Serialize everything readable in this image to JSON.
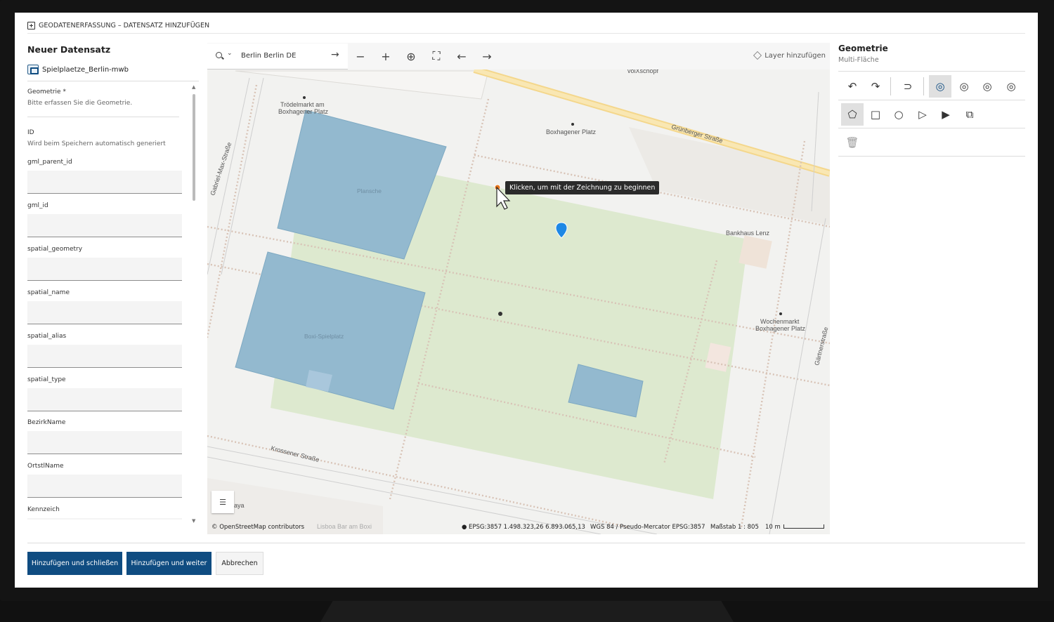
{
  "title": "GEODATENERFASSUNG – DATENSATZ HINZUFÜGEN",
  "left_panel": {
    "heading": "Neuer Datensatz",
    "dataset": "Spielplaetze_Berlin-mwb",
    "fields": [
      {
        "label": "Geometrie *",
        "hint": "Bitte erfassen Sie die Geometrie."
      },
      {
        "label": "ID",
        "hint": "Wird beim Speichern automatisch generiert"
      },
      {
        "label": "gml_parent_id",
        "value": ""
      },
      {
        "label": "gml_id",
        "value": ""
      },
      {
        "label": "spatial_geometry",
        "value": ""
      },
      {
        "label": "spatial_name",
        "value": ""
      },
      {
        "label": "spatial_alias",
        "value": ""
      },
      {
        "label": "spatial_type",
        "value": ""
      },
      {
        "label": "BezirkName",
        "value": ""
      },
      {
        "label": "OrtstlName",
        "value": ""
      },
      {
        "label": "Kennzeich",
        "value": ""
      }
    ]
  },
  "map": {
    "search": {
      "value": "Berlin  Berlin  DE"
    },
    "layer_button": "Layer hinzufügen",
    "tooltip": "Klicken, um mit der Zeichnung zu beginnen",
    "labels": {
      "troedelmarkt": "Trödelmarkt am",
      "troedelmarkt2": "Boxhagener Platz",
      "boxhagener": "Boxhagener Platz",
      "gruenberger": "Grünberger Straße",
      "gabriel": "Gabriel-Max-Straße",
      "bankhaus": "Bankhaus Lenz",
      "wochenmarkt": "Wochenmarkt",
      "wochenmarkt2": "Boxhagener Platz",
      "krossener": "Krossener Straße",
      "gaertner": "Gärtnerstraße",
      "plansche": "Plansche",
      "boxi": "Boxi-Spielplatz",
      "volxschopf": "volXschopf",
      "lisboa": "Lisboa Bar am Boxi",
      "aya": "aya"
    },
    "footer": {
      "attribution": "© OpenStreetMap contributors",
      "coords": "EPSG:3857 1.498.323,26  6.893.065,13",
      "crs": "WGS 84 / Pseudo-Mercator EPSG:3857",
      "scale": "Maßstab 1 : 805",
      "scalebar": "10 m"
    }
  },
  "right_panel": {
    "title": "Geometrie",
    "subtitle": "Multi-Fläche"
  },
  "buttons": {
    "add_close": "Hinzufügen und schließen",
    "add_next": "Hinzufügen und weiter",
    "cancel": "Abbrechen"
  },
  "colors": {
    "primary": "#0f4c81",
    "park": "#dde9cf",
    "water_poly": "#93b9cf"
  }
}
